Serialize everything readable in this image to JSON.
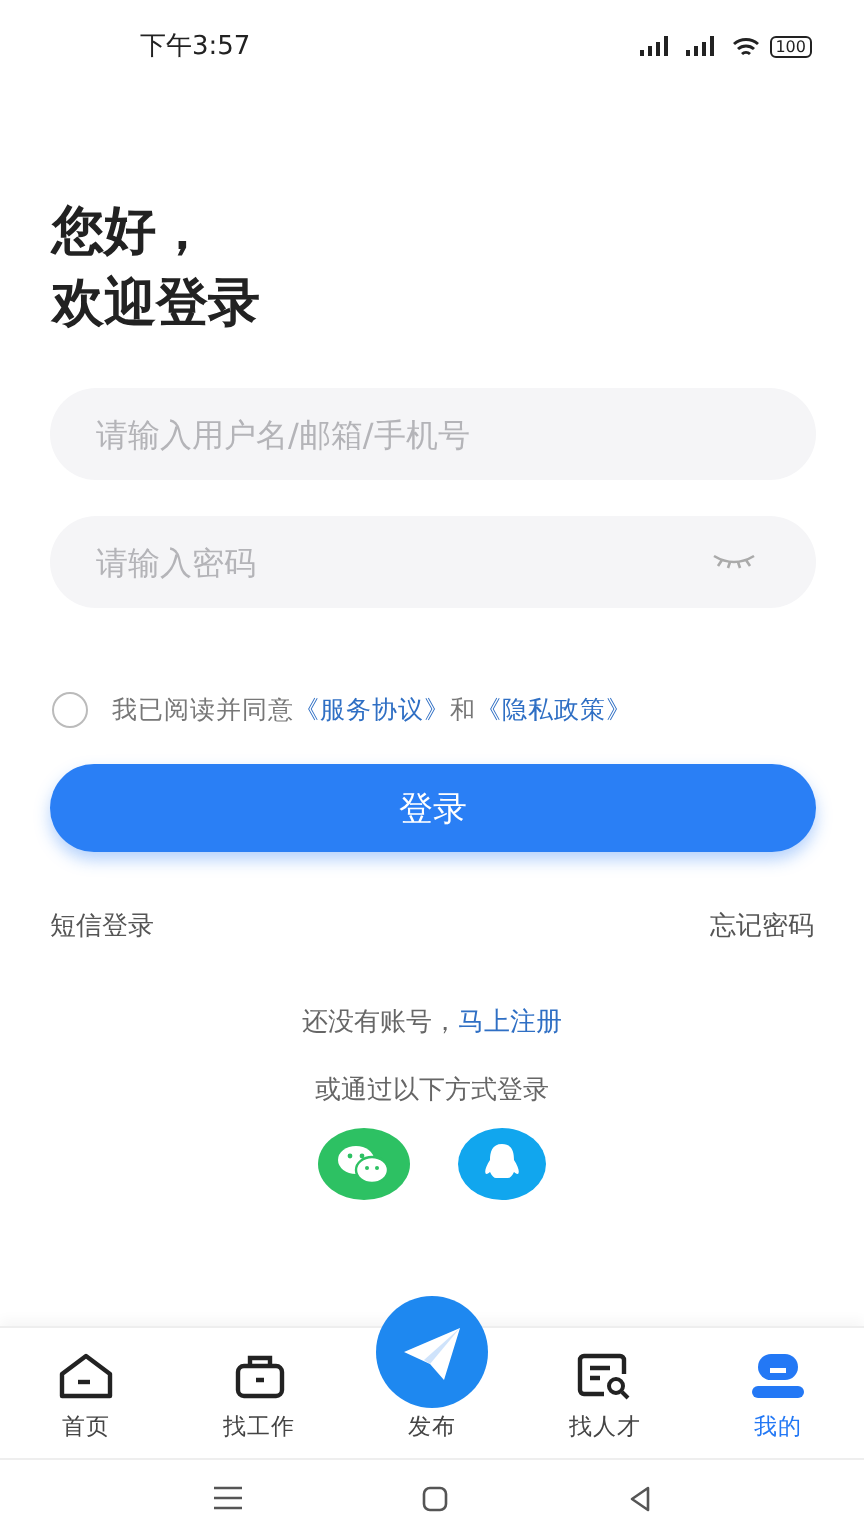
{
  "status_bar": {
    "time": "下午3:57",
    "battery": "100"
  },
  "greeting": [
    "您好，",
    "欢迎登录"
  ],
  "username_field": {
    "placeholder": "请输入用户名/邮箱/手机号"
  },
  "password_field": {
    "placeholder": "请输入密码",
    "visible": false
  },
  "agreement": {
    "checked": false,
    "text": "我已阅读并同意",
    "links": [
      "《服务协议》",
      "《隐私政策》"
    ],
    "joiner": "和"
  },
  "login_button": "登录",
  "sms_login": "短信登录",
  "forgot_password": "忘记密码",
  "register": {
    "text": "还没有账号，",
    "link": "马上注册"
  },
  "other_login": "或通过以下方式登录",
  "social": [
    {
      "kind": "wechat"
    },
    {
      "kind": "qq"
    }
  ],
  "tabs": [
    {
      "kind": "home",
      "label": "首页",
      "selected": false
    },
    {
      "kind": "job",
      "label": "找工作",
      "selected": false
    },
    {
      "kind": "publish",
      "label": "发布",
      "selected": false
    },
    {
      "kind": "talent",
      "label": "找人才",
      "selected": false
    },
    {
      "kind": "me",
      "label": "我的",
      "selected": true
    }
  ]
}
